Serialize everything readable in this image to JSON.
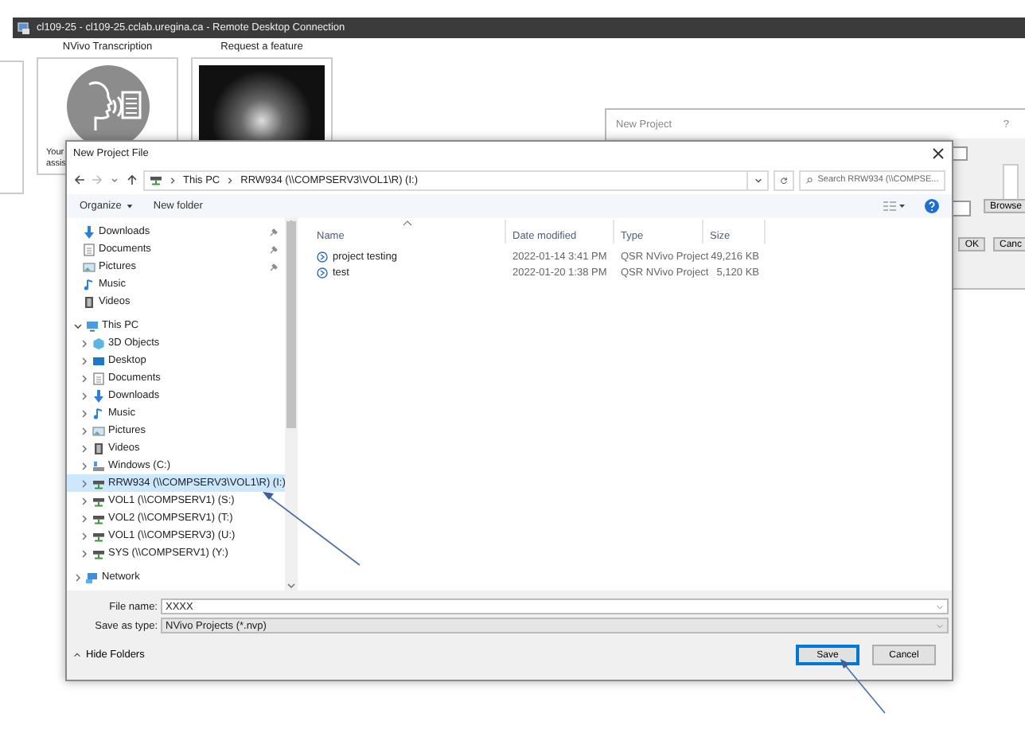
{
  "remote_window": {
    "title": "cl109-25 - cl109-25.cclab.uregina.ca - Remote Desktop Connection"
  },
  "feature_cards": [
    {
      "kind": "speech",
      "title": "NVivo Transcription",
      "text_lines": [
        "Your",
        "assis"
      ]
    },
    {
      "kind": "photo",
      "title": "Request a feature"
    }
  ],
  "background_window": {
    "title": "New Project",
    "help": "?",
    "buttons": [
      {
        "label": "Browse"
      },
      {
        "label": "OK"
      },
      {
        "label": "Canc"
      }
    ]
  },
  "save_dialog": {
    "title": "New Project File",
    "breadcrumbs": [
      "This PC",
      "RRW934 (\\\\COMPSERV3\\VOL1\\R) (I:)"
    ],
    "search": {
      "placeholder": "Search RRW934 (\\\\COMPSE..."
    },
    "toolbar": {
      "organize": "Organize",
      "new_folder": "New folder"
    },
    "nav": [
      {
        "kind": "download",
        "label": "Downloads",
        "pinned": true,
        "selected": false
      },
      {
        "kind": "document",
        "label": "Documents",
        "pinned": true,
        "selected": false
      },
      {
        "kind": "picture",
        "label": "Pictures",
        "pinned": true,
        "selected": false
      },
      {
        "kind": "music",
        "label": "Music",
        "pinned": false,
        "selected": false
      },
      {
        "kind": "video",
        "label": "Videos",
        "pinned": false,
        "selected": false
      },
      {
        "kind": "pc",
        "label": "This PC",
        "pinned": false,
        "selected": false,
        "expanded": true,
        "children": [
          {
            "kind": "cube",
            "label": "3D Objects",
            "selected": false,
            "expanded": false
          },
          {
            "kind": "desktop",
            "label": "Desktop",
            "selected": false,
            "expanded": false
          },
          {
            "kind": "document",
            "label": "Documents",
            "selected": false,
            "expanded": false
          },
          {
            "kind": "download",
            "label": "Downloads",
            "selected": false,
            "expanded": false
          },
          {
            "kind": "music",
            "label": "Music",
            "selected": false,
            "expanded": false
          },
          {
            "kind": "picture",
            "label": "Pictures",
            "selected": false,
            "expanded": false
          },
          {
            "kind": "video",
            "label": "Videos",
            "selected": false,
            "expanded": false
          },
          {
            "kind": "disk",
            "label": "Windows (C:)",
            "selected": false,
            "expanded": false
          },
          {
            "kind": "netdrive",
            "label": "RRW934 (\\\\COMPSERV3\\VOL1\\R) (I:)",
            "selected": true,
            "expanded": false
          },
          {
            "kind": "netdrive",
            "label": "VOL1 (\\\\COMPSERV1) (S:)",
            "selected": false,
            "expanded": false
          },
          {
            "kind": "netdrive",
            "label": "VOL2 (\\\\COMPSERV1) (T:)",
            "selected": false,
            "expanded": false
          },
          {
            "kind": "netdrive",
            "label": "VOL1 (\\\\COMPSERV3) (U:)",
            "selected": false,
            "expanded": false
          },
          {
            "kind": "netdrive",
            "label": "SYS (\\\\COMPSERV1) (Y:)",
            "selected": false,
            "expanded": false
          }
        ]
      },
      {
        "kind": "network",
        "label": "Network",
        "pinned": false,
        "selected": false,
        "expanded": false
      }
    ],
    "columns": [
      {
        "label": "Name",
        "sorted": true
      },
      {
        "label": "Date modified",
        "sorted": false
      },
      {
        "label": "Type",
        "sorted": false
      },
      {
        "label": "Size",
        "sorted": false
      }
    ],
    "rows": [
      {
        "name": "project testing",
        "date": "2022-01-14 3:41 PM",
        "type": "QSR NVivo Project",
        "size": "49,216 KB"
      },
      {
        "name": "test",
        "date": "2022-01-20 1:38 PM",
        "type": "QSR NVivo Project",
        "size": "5,120 KB"
      }
    ],
    "file_name": {
      "label": "File name:",
      "value": "XXXX"
    },
    "save_as_type": {
      "label": "Save as type:",
      "value": "NVivo Projects (*.nvp)"
    },
    "hide_folders": "Hide Folders",
    "buttons": [
      {
        "label": "Save",
        "default": true
      },
      {
        "label": "Cancel",
        "default": false
      }
    ]
  }
}
